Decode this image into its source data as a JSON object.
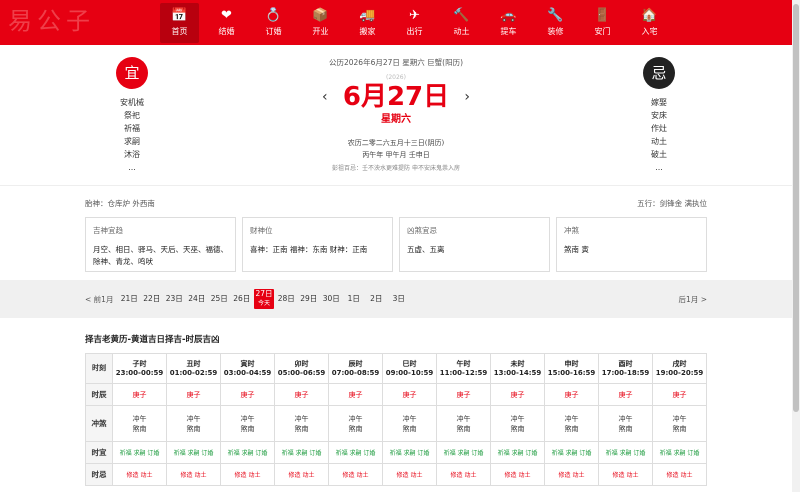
{
  "brand": {
    "logo_text": "易公子"
  },
  "nav": [
    {
      "label": "首页",
      "icon": "calendar-icon",
      "glyph": "📅"
    },
    {
      "label": "结婚",
      "icon": "heart-icon",
      "glyph": "❤"
    },
    {
      "label": "订婚",
      "icon": "ring-icon",
      "glyph": "💍"
    },
    {
      "label": "开业",
      "icon": "box-icon",
      "glyph": "📦"
    },
    {
      "label": "搬家",
      "icon": "truck-icon",
      "glyph": "🚚"
    },
    {
      "label": "出行",
      "icon": "plane-icon",
      "glyph": "✈"
    },
    {
      "label": "动土",
      "icon": "hammer-icon",
      "glyph": "🔨"
    },
    {
      "label": "提车",
      "icon": "car-icon",
      "glyph": "🚗"
    },
    {
      "label": "装修",
      "icon": "wrench-icon",
      "glyph": "🔧"
    },
    {
      "label": "安门",
      "icon": "door-icon",
      "glyph": "🚪"
    },
    {
      "label": "入宅",
      "icon": "house-icon",
      "glyph": "🏠"
    }
  ],
  "hero": {
    "yi_label": "宜",
    "ji_label": "忌",
    "yi_items": [
      "安机械",
      "祭祀",
      "祈福",
      "求嗣",
      "沐浴",
      "..."
    ],
    "ji_items": [
      "嫁娶",
      "安床",
      "作灶",
      "动土",
      "破土",
      "..."
    ],
    "solar_line": "公历2026年6月27日 星期六 巨蟹(阳历)",
    "year_small": "(2026)",
    "big_date": "6月27日",
    "weekday": "星期六",
    "prev_arrow": "‹",
    "next_arrow": "›",
    "lunar_line": "农历二零二六五月十三日(阴历)",
    "ganzhi_line": "丙午年 甲午月 壬申日",
    "pengzu": "彭祖百忌：壬不泱水更难提防 申不安床鬼祟入房"
  },
  "info": {
    "fetal": "胎神：仓库炉 外西南",
    "wuxing": "五行：剑锋金 满执位",
    "cards": [
      {
        "title": "吉神宜趋",
        "text": "月空、相日、驿马、天后、天巫、福德、除神、青龙、鸣吠"
      },
      {
        "title": "财神位",
        "text": "喜神：正南 福神：东南 财神：正南"
      },
      {
        "title": "凶煞宜忌",
        "text": "五虚、五离"
      },
      {
        "title": "冲煞",
        "text": "煞南 寅"
      }
    ]
  },
  "datebar": {
    "prev": "< 前1月",
    "next": "后1月 >",
    "days": [
      "21日",
      "22日",
      "23日",
      "24日",
      "25日",
      "26日",
      "27日",
      "28日",
      "29日",
      "30日",
      "1日",
      "2日",
      "3日"
    ],
    "active_index": 6,
    "today_label": "今天"
  },
  "hours_section": {
    "title": "择吉老黄历-黄道吉日择吉-时辰吉凶",
    "row_labels": {
      "header": "时刻",
      "chen": "时辰",
      "chong": "冲煞",
      "yi": "时宜",
      "ji": "时忌"
    },
    "columns": [
      {
        "name": "子时",
        "range": "23:00-00:59"
      },
      {
        "name": "丑时",
        "range": "01:00-02:59"
      },
      {
        "name": "寅时",
        "range": "03:00-04:59"
      },
      {
        "name": "卯时",
        "range": "05:00-06:59"
      },
      {
        "name": "辰时",
        "range": "07:00-08:59"
      },
      {
        "name": "巳时",
        "range": "09:00-10:59"
      },
      {
        "name": "午时",
        "range": "11:00-12:59"
      },
      {
        "name": "未时",
        "range": "13:00-14:59"
      },
      {
        "name": "申时",
        "range": "15:00-16:59"
      },
      {
        "name": "酉时",
        "range": "17:00-18:59"
      },
      {
        "name": "戌时",
        "range": "19:00-20:59"
      }
    ],
    "chen_value": "庚子",
    "chong_line1": "冲午",
    "chong_line2": "煞南",
    "yi_value": "祈福 求嗣 订婚",
    "ji_value": "修造 动土"
  },
  "colors": {
    "brand_red": "#e60012",
    "good_green": "#1a9a3c"
  }
}
